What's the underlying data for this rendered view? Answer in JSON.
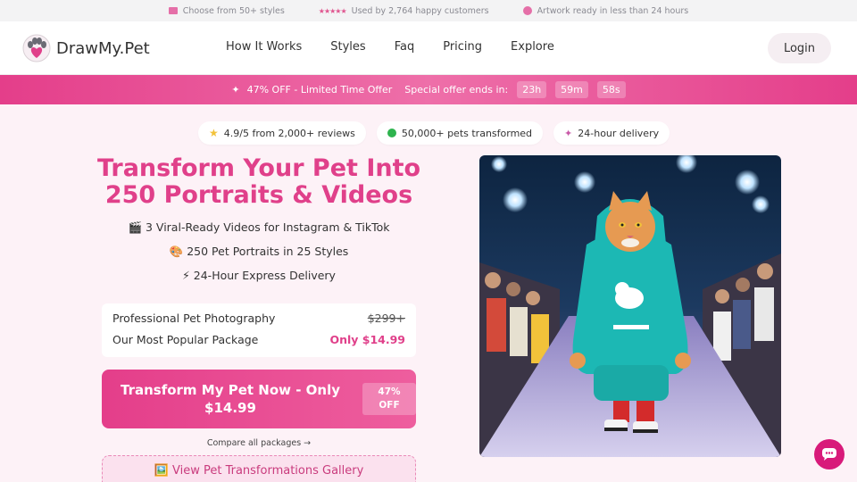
{
  "topbar": {
    "item1": "Choose from 50+ styles",
    "stars": "★★★★★",
    "item2": "Used by 2,764 happy customers",
    "item3": "Artwork ready in less than 24 hours"
  },
  "nav": {
    "logo": "DrawMy.Pet",
    "links": [
      "How It Works",
      "Styles",
      "Faq",
      "Pricing",
      "Explore"
    ],
    "login": "Login"
  },
  "offer": {
    "label": "47% OFF - Limited Time Offer",
    "ends": "Special offer ends in:",
    "hours": "23h",
    "minutes": "59m",
    "seconds": "58s"
  },
  "badges": [
    "4.9/5 from 2,000+ reviews",
    "50,000+ pets transformed",
    "24-hour delivery"
  ],
  "hero": {
    "headline_line1": "Transform Your Pet Into",
    "headline_line2": "250 Portraits & Videos",
    "features": [
      "🎬 3 Viral-Ready Videos for Instagram & TikTok",
      "🎨 250 Pet Portraits in 25 Styles",
      "⚡ 24-Hour Express Delivery"
    ]
  },
  "pricing": {
    "row1_label": "Professional Pet Photography",
    "row1_value": "$299+",
    "row2_label": "Our Most Popular Package",
    "row2_value": "Only $14.99"
  },
  "cta": {
    "line1": "Transform My Pet Now - Only",
    "line2": "$14.99",
    "badge_line1": "47%",
    "badge_line2": "OFF"
  },
  "compare": "Compare all packages →",
  "gallery": "🖼️ View Pet Transformations Gallery",
  "colors": {
    "accent": "#e0408a",
    "offer_bar": "#e43e8a",
    "chat": "#d81a7a"
  },
  "icons": [
    "gift-icon",
    "stars-icon",
    "clock-icon",
    "paw-logo-icon",
    "sparkle-icon",
    "star-icon",
    "check-icon",
    "chat-icon"
  ]
}
